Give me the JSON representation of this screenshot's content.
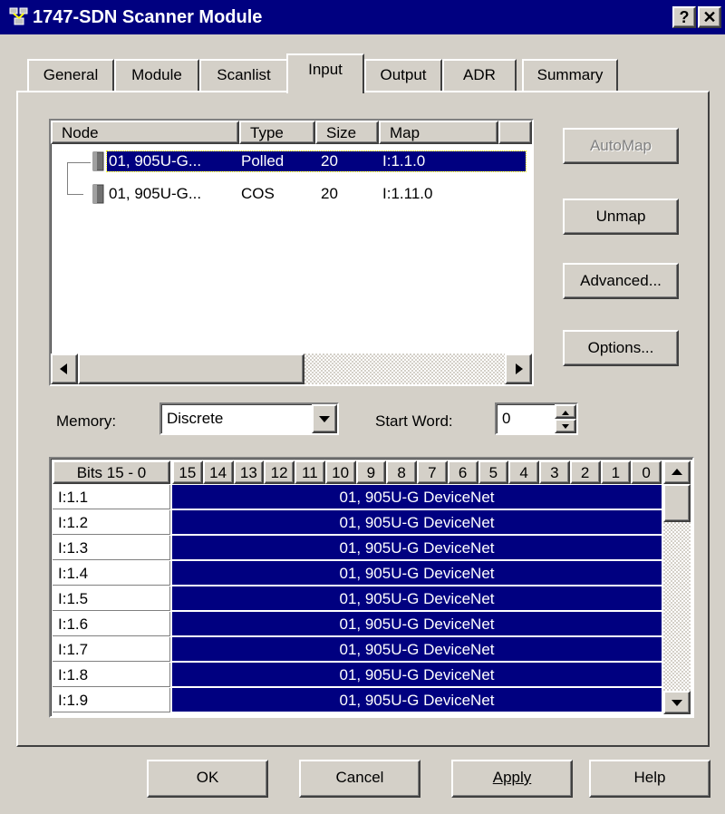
{
  "window": {
    "title": "1747-SDN Scanner Module",
    "help_btn": "?",
    "close_btn": "✕"
  },
  "tabs": [
    {
      "label": "General"
    },
    {
      "label": "Module"
    },
    {
      "label": "Scanlist"
    },
    {
      "label": "Input"
    },
    {
      "label": "Output"
    },
    {
      "label": "ADR"
    },
    {
      "label": "Summary"
    }
  ],
  "active_tab": "Input",
  "node_list": {
    "columns": [
      "Node",
      "Type",
      "Size",
      "Map"
    ],
    "rows": [
      {
        "node": "01, 905U-G...",
        "type": "Polled",
        "size": "20",
        "map": "I:1.1.0",
        "selected": true
      },
      {
        "node": "01, 905U-G...",
        "type": "COS",
        "size": "20",
        "map": "I:1.11.0",
        "selected": false
      }
    ]
  },
  "buttons": {
    "automap": "AutoMap",
    "unmap": "Unmap",
    "advanced": "Advanced...",
    "options": "Options..."
  },
  "memory": {
    "label": "Memory:",
    "value": "Discrete"
  },
  "start_word": {
    "label": "Start Word:",
    "value": "0"
  },
  "bit_grid": {
    "header_label": "Bits 15 - 0",
    "bits": [
      "15",
      "14",
      "13",
      "12",
      "11",
      "10",
      "9",
      "8",
      "7",
      "6",
      "5",
      "4",
      "3",
      "2",
      "1",
      "0"
    ],
    "rows": [
      {
        "addr": "I:1.1",
        "device": "01, 905U-G DeviceNet"
      },
      {
        "addr": "I:1.2",
        "device": "01, 905U-G DeviceNet"
      },
      {
        "addr": "I:1.3",
        "device": "01, 905U-G DeviceNet"
      },
      {
        "addr": "I:1.4",
        "device": "01, 905U-G DeviceNet"
      },
      {
        "addr": "I:1.5",
        "device": "01, 905U-G DeviceNet"
      },
      {
        "addr": "I:1.6",
        "device": "01, 905U-G DeviceNet"
      },
      {
        "addr": "I:1.7",
        "device": "01, 905U-G DeviceNet"
      },
      {
        "addr": "I:1.8",
        "device": "01, 905U-G DeviceNet"
      },
      {
        "addr": "I:1.9",
        "device": "01, 905U-G DeviceNet"
      }
    ]
  },
  "footer": {
    "ok": "OK",
    "cancel": "Cancel",
    "apply": "Apply",
    "help": "Help"
  },
  "icons": {
    "app": "network-icon",
    "device": "device-icon"
  }
}
